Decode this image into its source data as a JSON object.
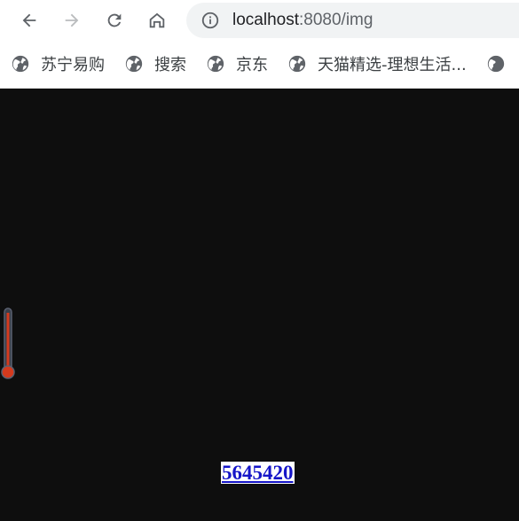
{
  "browser": {
    "address_bar": {
      "host": "localhost",
      "path": ":8080/img",
      "icon": "info-icon"
    },
    "nav": {
      "back_icon": "arrow-left-icon",
      "forward_icon": "arrow-right-icon",
      "reload_icon": "reload-icon",
      "home_icon": "home-icon"
    },
    "bookmarks": [
      {
        "label": "苏宁易购",
        "icon": "globe-icon"
      },
      {
        "label": "搜索",
        "icon": "globe-icon"
      },
      {
        "label": "京东",
        "icon": "globe-icon"
      },
      {
        "label": "天猫精选-理想生活...",
        "icon": "globe-icon"
      }
    ]
  },
  "page": {
    "background": "#0e0e0e",
    "value_text": "5645420",
    "value_color": "#1515c8",
    "thermometer_color": "#d43a1e"
  }
}
